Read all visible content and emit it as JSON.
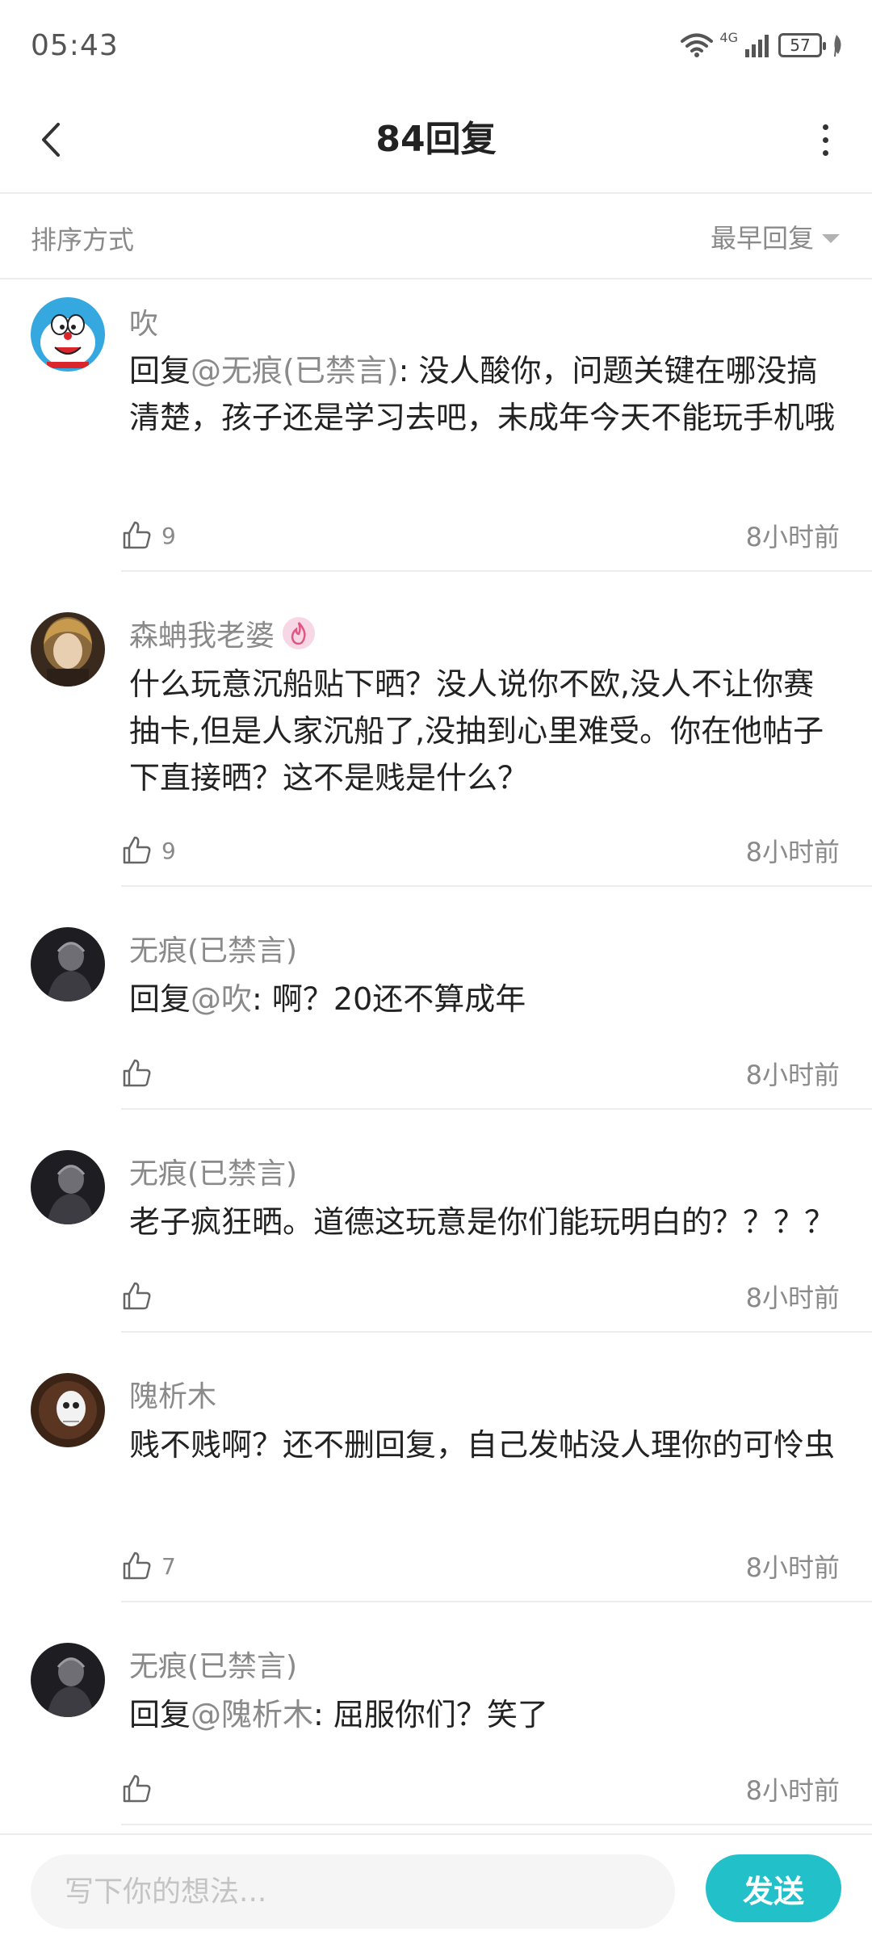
{
  "status_bar": {
    "time": "05:43",
    "network": "4G",
    "battery": "57"
  },
  "header": {
    "title": "84回复"
  },
  "sort": {
    "label": "排序方式",
    "selected": "最早回复"
  },
  "comments": [
    {
      "user": "吹",
      "reply_prefix": "回复",
      "mention": "@无痕(已禁言)",
      "text": ": 没人酸你，问题关键在哪没搞清楚，孩子还是学习去吧，未成年今天不能玩手机哦",
      "likes": "9",
      "time": "8小时前",
      "avatar": "doraemon-avatar"
    },
    {
      "user": "森蚺我老婆",
      "has_badge": true,
      "reply_prefix": "",
      "mention": "",
      "text": "什么玩意沉船贴下晒？没人说你不欧,没人不让你赛抽卡,但是人家沉船了,没抽到心里难受。你在他帖子下直接晒？这不是贱是什么？",
      "likes": "9",
      "time": "8小时前",
      "avatar": "anime-girl-avatar"
    },
    {
      "user": "无痕(已禁言)",
      "reply_prefix": "回复",
      "mention": "@吹",
      "text": ": 啊？20还不算成年",
      "likes": "",
      "time": "8小时前",
      "avatar": "dark-figure-avatar"
    },
    {
      "user": "无痕(已禁言)",
      "reply_prefix": "",
      "mention": "",
      "text": "老子疯狂晒。道德这玩意是你们能玩明白的？？？？",
      "likes": "",
      "time": "8小时前",
      "avatar": "dark-figure-avatar"
    },
    {
      "user": "隗析木",
      "reply_prefix": "",
      "mention": "",
      "text": "贱不贱啊？还不删回复，自己发帖没人理你的可怜虫",
      "likes": "7",
      "time": "8小时前",
      "avatar": "mask-avatar"
    },
    {
      "user": "无痕(已禁言)",
      "reply_prefix": "回复",
      "mention": "@隗析木",
      "text": ": 屈服你们？笑了",
      "likes": "",
      "time": "8小时前",
      "avatar": "dark-figure-avatar"
    }
  ],
  "composer": {
    "placeholder": "写下你的想法...",
    "send_label": "发送"
  },
  "colors": {
    "accent": "#22c0c8",
    "muted_text": "#8a8a8a",
    "divider": "#ececec"
  }
}
